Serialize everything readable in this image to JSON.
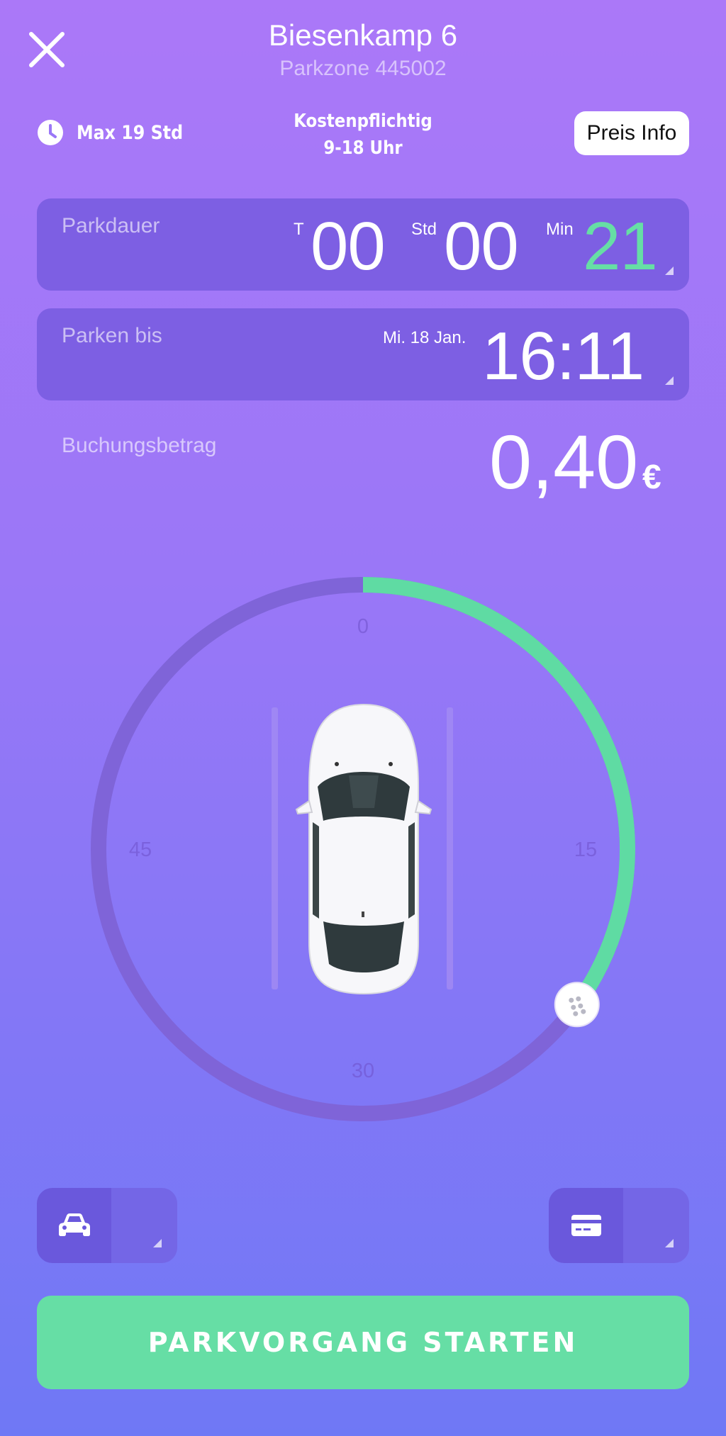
{
  "header": {
    "close_icon": "close-icon",
    "title": "Biesenkamp 6",
    "subtitle": "Parkzone 445002"
  },
  "info": {
    "max_label": "Max 19 Std",
    "max_icon": "clock-icon",
    "cost_line1": "Kostenpflichtig",
    "cost_line2": "9-18 Uhr",
    "price_button": "Preis Info"
  },
  "duration": {
    "label": "Parkdauer",
    "days_unit": "T",
    "days": "00",
    "hours_unit": "Std",
    "hours": "00",
    "minutes_unit": "Min",
    "minutes": "21"
  },
  "until": {
    "label": "Parken bis",
    "date": "Mi. 18 Jan.",
    "time": "16:11"
  },
  "amount": {
    "label": "Buchungsbetrag",
    "value": "0,40",
    "currency": "€"
  },
  "dial": {
    "labels": {
      "top": "0",
      "right": "15",
      "bottom": "30",
      "left": "45"
    },
    "minutes_selected": 21,
    "minutes_total": 60,
    "track_color": "#7f64d8",
    "progress_color": "#5fdba3",
    "handle_icon": "grip-icon",
    "center_icon": "car-top-view-icon"
  },
  "bottom": {
    "vehicle_icon": "car-icon",
    "payment_icon": "credit-card-icon",
    "start_button": "PARKVORGANG STARTEN"
  },
  "colors": {
    "accent_green": "#66dea5",
    "card_bg": "#7d5fe3"
  }
}
